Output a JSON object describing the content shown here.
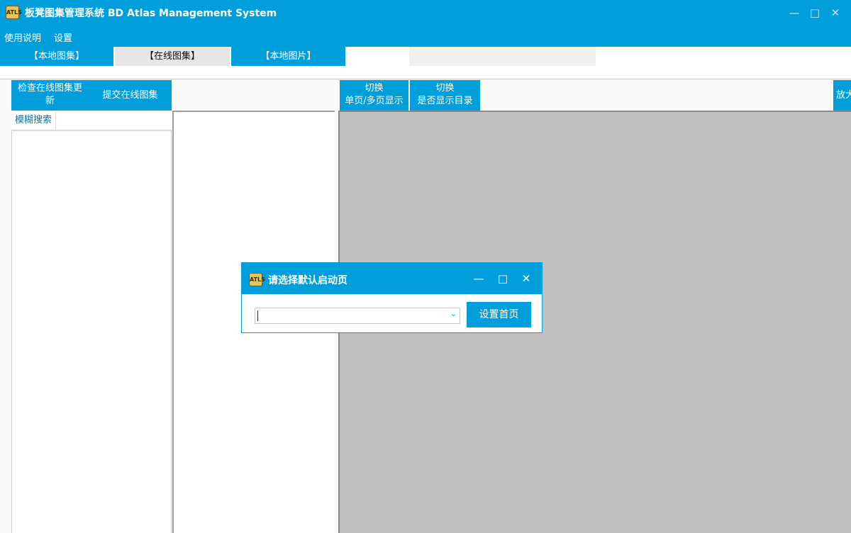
{
  "window": {
    "icon_text": "ATLS",
    "title": "板凳图集管理系统 BD Atlas Management System",
    "minimize_glyph": "—",
    "maximize_glyph": "□",
    "close_glyph": "✕"
  },
  "menu": {
    "items": [
      "使用说明",
      "设置"
    ]
  },
  "tabs": [
    {
      "label": "【本地图集】"
    },
    {
      "label": "【在线图集】"
    },
    {
      "label": "【本地图片】"
    }
  ],
  "left_toolbar": {
    "check_update_line1": "检查在线图集更",
    "check_update_line2": "新",
    "submit_label": "提交在线图集"
  },
  "search": {
    "label": "模糊搜索",
    "value": ""
  },
  "viewer_toolbar": {
    "toggle_page_line1": "切换",
    "toggle_page_line2": "单页/多页显示",
    "toggle_toc_line1": "切换",
    "toggle_toc_line2": "是否显示目录",
    "zoom_label": "放大"
  },
  "dialog": {
    "icon_text": "ATLS",
    "title": "请选择默认启动页",
    "minimize_glyph": "—",
    "maximize_glyph": "□",
    "close_glyph": "✕",
    "select_value": "",
    "set_home_label": "设置首页"
  },
  "colors": {
    "accent": "#009fdc",
    "viewer_bg": "#c0c0c0",
    "active_tab": "#e6e6e6"
  }
}
